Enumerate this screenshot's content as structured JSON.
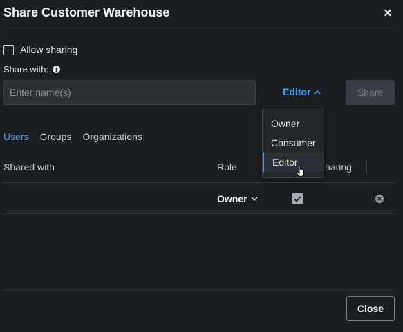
{
  "dialog": {
    "title": "Share Customer Warehouse",
    "close_icon": "close-icon"
  },
  "allow_sharing": {
    "label": "Allow sharing",
    "checked": false
  },
  "share_with": {
    "label": "Share with:",
    "info_icon": "info-icon"
  },
  "name_input": {
    "placeholder": "Enter name(s)",
    "value": ""
  },
  "role_dropdown": {
    "selected": "Editor",
    "expanded": true,
    "icon": "chevron-up-icon"
  },
  "share_button": {
    "label": "Share",
    "enabled": false
  },
  "role_menu": {
    "options": [
      "Owner",
      "Consumer",
      "Editor"
    ],
    "selected": "Editor"
  },
  "tabs": [
    {
      "label": "Users",
      "active": true
    },
    {
      "label": "Groups",
      "active": false
    },
    {
      "label": "Organizations",
      "active": false
    }
  ],
  "table": {
    "columns": [
      "Shared with",
      "Role",
      "Can share"
    ],
    "column_visible_text": [
      "Shared with",
      "Role",
      "haring"
    ],
    "rows": [
      {
        "name": "",
        "role": "Owner",
        "can_share": true
      }
    ]
  },
  "footer": {
    "close_label": "Close"
  },
  "colors": {
    "background": "#1b1e22",
    "accent": "#4aa3f0",
    "input_bg": "#2c3035",
    "disabled_button": "#3a3e44"
  }
}
